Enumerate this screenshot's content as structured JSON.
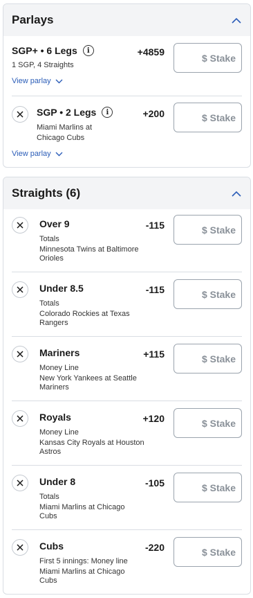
{
  "parlays": {
    "title": "Parlays",
    "items": [
      {
        "title": "SGP+ • 6 Legs",
        "subtitle": "1 SGP, 4 Straights",
        "odds": "+4859",
        "stake_placeholder": "$ Stake",
        "link": "View parlay"
      },
      {
        "title": "SGP • 2 Legs",
        "subtitle": "Miami Marlins at Chicago Cubs",
        "odds": "+200",
        "stake_placeholder": "$ Stake",
        "link": "View parlay"
      }
    ]
  },
  "straights": {
    "title": "Straights (6)",
    "items": [
      {
        "title": "Over 9",
        "market": "Totals",
        "event": "Minnesota Twins at Baltimore Orioles",
        "odds": "-115",
        "stake_placeholder": "$ Stake"
      },
      {
        "title": "Under 8.5",
        "market": "Totals",
        "event": "Colorado Rockies at Texas Rangers",
        "odds": "-115",
        "stake_placeholder": "$ Stake"
      },
      {
        "title": "Mariners",
        "market": "Money Line",
        "event": "New York Yankees at Seattle Mariners",
        "odds": "+115",
        "stake_placeholder": "$ Stake"
      },
      {
        "title": "Royals",
        "market": "Money Line",
        "event": "Kansas City Royals at Houston Astros",
        "odds": "+120",
        "stake_placeholder": "$ Stake"
      },
      {
        "title": "Under 8",
        "market": "Totals",
        "event": "Miami Marlins at Chicago Cubs",
        "odds": "-105",
        "stake_placeholder": "$ Stake"
      },
      {
        "title": "Cubs",
        "market": "First 5 innings: Money line",
        "event": "Miami Marlins at Chicago Cubs",
        "odds": "-220",
        "stake_placeholder": "$ Stake"
      }
    ]
  },
  "colors": {
    "accent": "#2b5db8",
    "header_bg": "#f3f4f6",
    "border": "#d9dde3"
  },
  "icons": {
    "collapse": "chevron-up-icon",
    "expand": "chevron-down-icon",
    "remove": "close-icon",
    "info": "info-icon"
  }
}
